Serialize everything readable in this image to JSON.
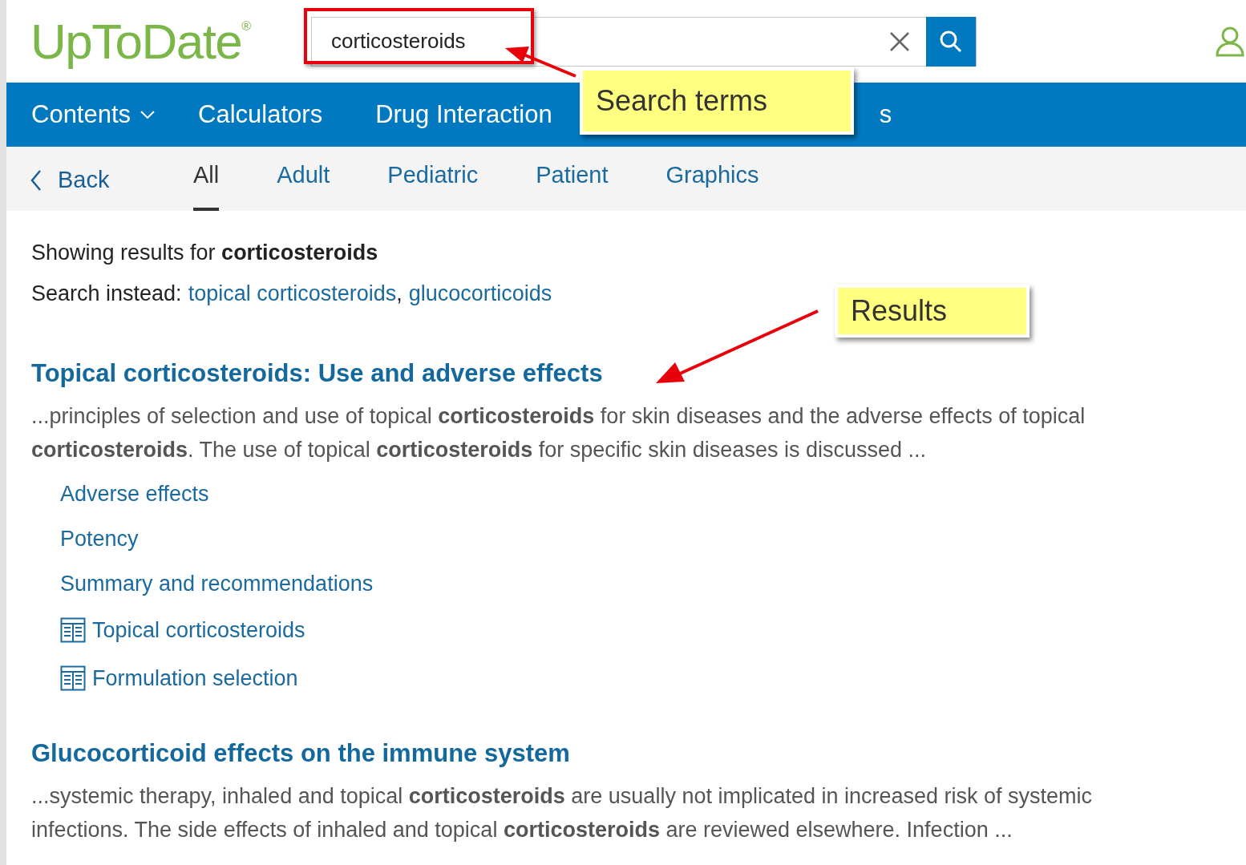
{
  "logo": {
    "text": "UpToDate",
    "mark": "®"
  },
  "search": {
    "value": "corticosteroids"
  },
  "nav": [
    {
      "label": "Contents",
      "kind": "dropdown"
    },
    {
      "label": "Calculators",
      "kind": "link"
    },
    {
      "label": "Drug Interaction",
      "kind": "link"
    },
    {
      "label": "s",
      "kind": "link"
    }
  ],
  "filters": {
    "back": "Back",
    "tabs": [
      {
        "label": "All",
        "selected": true
      },
      {
        "label": "Adult",
        "selected": false
      },
      {
        "label": "Pediatric",
        "selected": false
      },
      {
        "label": "Patient",
        "selected": false
      },
      {
        "label": "Graphics",
        "selected": false
      }
    ]
  },
  "query": {
    "showing": "Showing results for **corticosteroids**",
    "instead_label": "Search instead:",
    "suggestions": [
      "topical corticosteroids",
      "glucocorticoids"
    ],
    "separator": ","
  },
  "results": [
    {
      "title": "Topical corticosteroids: Use and adverse effects",
      "snippet": "...principles of selection and use of topical **corticosteroids** for skin diseases and the adverse effects of topical **corticosteroids**. The use of topical **corticosteroids** for specific skin diseases is discussed ...",
      "links": [
        {
          "label": "Adverse effects",
          "kind": "section"
        },
        {
          "label": "Potency",
          "kind": "section"
        },
        {
          "label": "Summary and recommendations",
          "kind": "section"
        },
        {
          "label": "Topical corticosteroids",
          "kind": "graphic"
        },
        {
          "label": "Formulation selection",
          "kind": "graphic"
        }
      ]
    },
    {
      "title": "Glucocorticoid effects on the immune system",
      "snippet": "...systemic therapy, inhaled and topical **corticosteroids** are usually not implicated in increased risk of systemic infections. The side effects of inhaled and topical **corticosteroids** are reviewed elsewhere. Infection ..."
    }
  ],
  "annotations": [
    {
      "text": "Search terms",
      "kind": "search"
    },
    {
      "text": "Results",
      "kind": "results"
    }
  ]
}
